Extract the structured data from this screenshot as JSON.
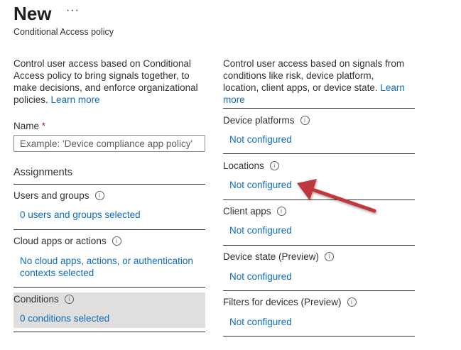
{
  "header": {
    "title": "New",
    "more_label": "···",
    "subtitle": "Conditional Access policy"
  },
  "left": {
    "intro_text": "Control user access based on Conditional Access policy to bring signals together, to make decisions, and enforce organizational policies.",
    "intro_link": "Learn more",
    "name_label": "Name",
    "name_required": "*",
    "name_placeholder": "Example: 'Device compliance app policy'",
    "assignments_label": "Assignments",
    "sections": [
      {
        "label": "Users and groups",
        "value": "0 users and groups selected"
      },
      {
        "label": "Cloud apps or actions",
        "value": "No cloud apps, actions, or authentication contexts selected"
      },
      {
        "label": "Conditions",
        "value": "0 conditions selected"
      }
    ]
  },
  "right": {
    "intro_text": "Control user access based on signals from conditions like risk, device platform, location, client apps, or device state.",
    "intro_link": "Learn more",
    "sections": [
      {
        "label": "Device platforms",
        "value": "Not configured"
      },
      {
        "label": "Locations",
        "value": "Not configured"
      },
      {
        "label": "Client apps",
        "value": "Not configured"
      },
      {
        "label": "Device state (Preview)",
        "value": "Not configured"
      },
      {
        "label": "Filters for devices (Preview)",
        "value": "Not configured"
      }
    ]
  },
  "icons": {
    "info": "info-icon",
    "annotation": "red-arrow-icon"
  },
  "colors": {
    "link": "#0f6cbd",
    "required": "#a4262c",
    "highlight": "#e1dfdd",
    "arrow": "#c0393b"
  }
}
